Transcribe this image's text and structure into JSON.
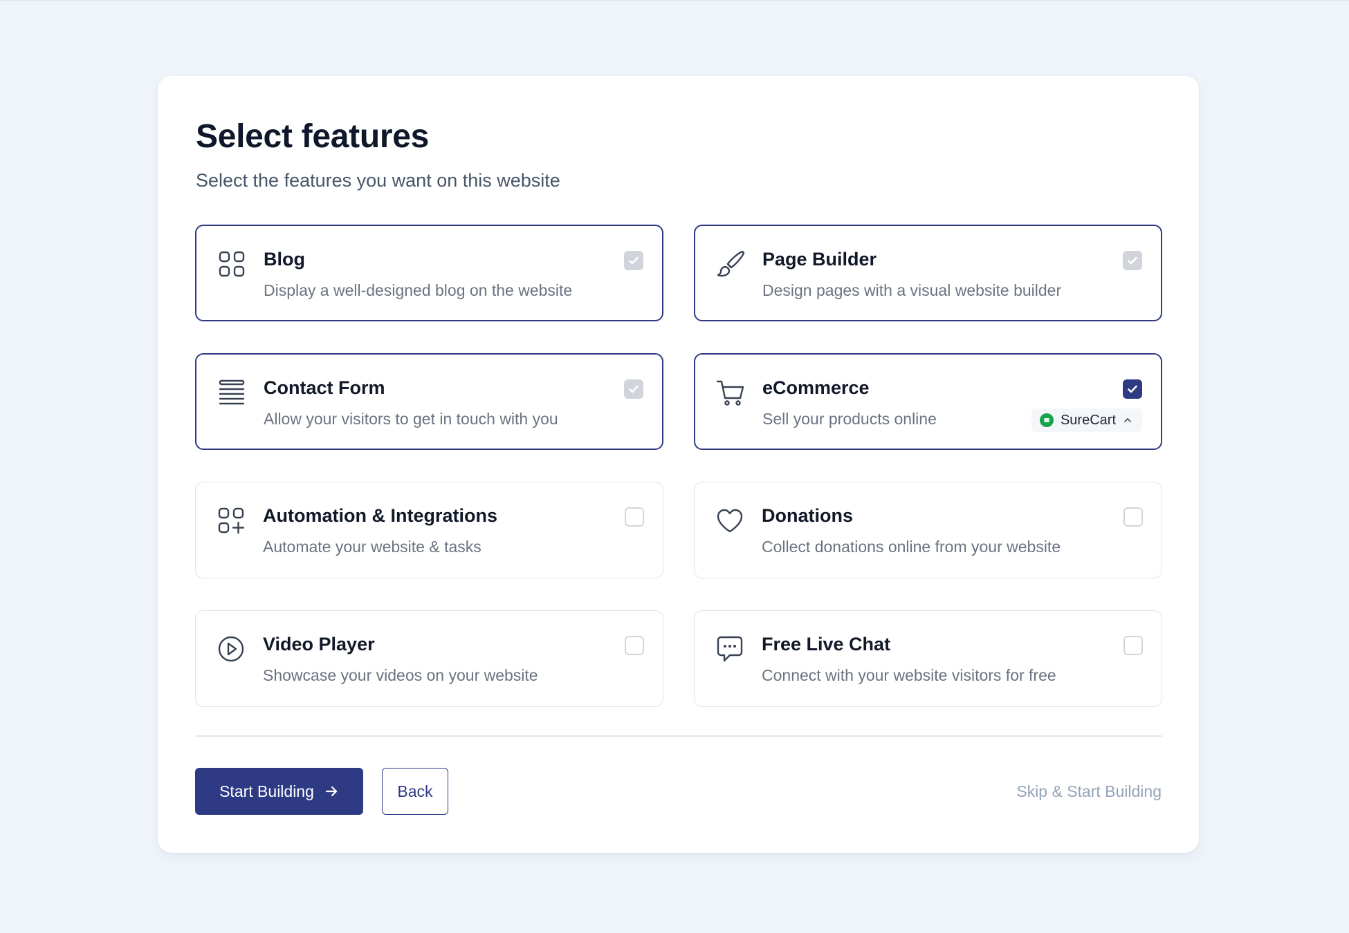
{
  "header": {
    "title": "Select features",
    "subtitle": "Select the features you want on this website"
  },
  "features": [
    {
      "name": "Blog",
      "description": "Display a well-designed blog on the website",
      "icon": "grid-icon",
      "state": "locked"
    },
    {
      "name": "Page Builder",
      "description": "Design pages with a visual website builder",
      "icon": "paintbrush-icon",
      "state": "locked"
    },
    {
      "name": "Contact Form",
      "description": "Allow your visitors to get in touch with you",
      "icon": "form-lines-icon",
      "state": "locked"
    },
    {
      "name": "eCommerce",
      "description": "Sell your products online",
      "icon": "shopping-cart-icon",
      "state": "checked",
      "addon": {
        "label": "SureCart",
        "icon": "surecart-logo-icon"
      }
    },
    {
      "name": "Automation & Integrations",
      "description": "Automate your website & tasks",
      "icon": "grid-plus-icon",
      "state": "unchecked"
    },
    {
      "name": "Donations",
      "description": "Collect donations online from your website",
      "icon": "heart-icon",
      "state": "unchecked"
    },
    {
      "name": "Video Player",
      "description": "Showcase your videos on your website",
      "icon": "play-circle-icon",
      "state": "unchecked"
    },
    {
      "name": "Free Live Chat",
      "description": "Connect with your website visitors for free",
      "icon": "chat-bubble-icon",
      "state": "unchecked"
    }
  ],
  "footer": {
    "primary_label": "Start Building",
    "back_label": "Back",
    "skip_label": "Skip & Start Building"
  },
  "colors": {
    "accent": "#2f3a84",
    "page_bg": "#eff4fb",
    "locked_check": "#d1d5db",
    "surecart_green": "#16a34a"
  }
}
